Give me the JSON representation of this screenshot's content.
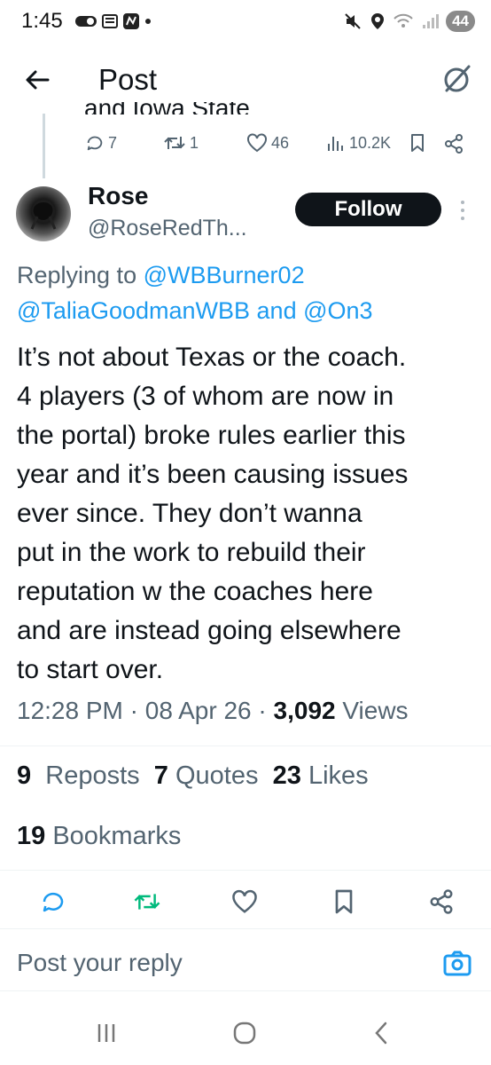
{
  "status_bar": {
    "time": "1:45",
    "battery": "44"
  },
  "header": {
    "title": "Post"
  },
  "parent_post": {
    "cut_text": "and Iowa State",
    "replies": "7",
    "reposts": "1",
    "likes": "46",
    "views": "10.2K"
  },
  "post": {
    "display_name": "Rose",
    "handle": "@RoseRedTh...",
    "follow_label": "Follow",
    "replying_prefix": "Replying to",
    "mentions": [
      "@WBBurner02",
      "@TaliaGoodmanWBB",
      "@On3"
    ],
    "mention_joiner": "and",
    "body_lines": [
      "It’s not about Texas or the coach.",
      "4 players (3 of whom are now in",
      "the portal) broke rules earlier this",
      "year and it’s been causing issues",
      "ever since. They don’t wanna",
      "put in the work to rebuild their",
      "reputation w the coaches here",
      "and are instead going elsewhere",
      "to start over."
    ],
    "time": "12:28 PM",
    "date": "08 Apr 26",
    "views_count": "3,092",
    "views_label": "Views",
    "sep": "·"
  },
  "stats": {
    "reposts_count": "9",
    "reposts_label": "Reposts",
    "quotes_count": "7",
    "quotes_label": "Quotes",
    "likes_count": "23",
    "likes_label": "Likes",
    "bookmarks_count": "19",
    "bookmarks_label": "Bookmarks"
  },
  "reply_box": {
    "placeholder": "Post your reply"
  },
  "colors": {
    "accent": "#1d9bf0",
    "repost_green": "#00ba7c",
    "text": "#0f1419",
    "muted": "#536471"
  },
  "icons": [
    "back-arrow-icon",
    "grok-icon",
    "reply-icon",
    "repost-icon",
    "like-icon",
    "views-icon",
    "bookmark-icon",
    "share-icon",
    "camera-icon"
  ]
}
